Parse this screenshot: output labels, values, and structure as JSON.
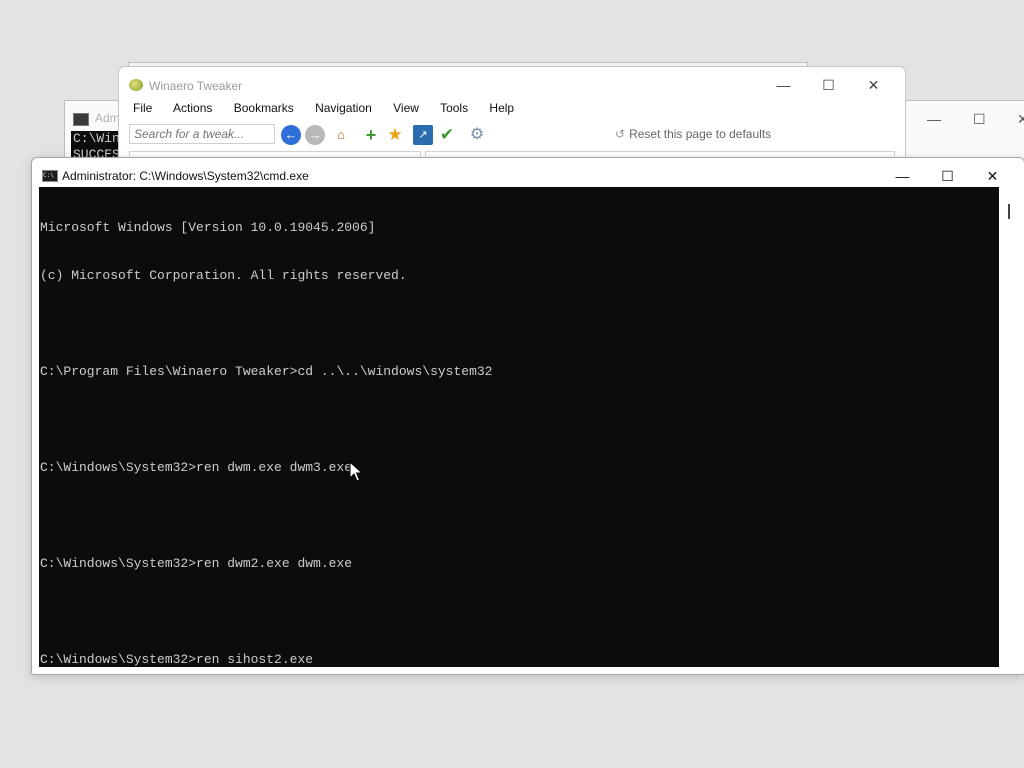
{
  "background_windows": {
    "back_cmd": {
      "title": "Admi",
      "console_lines": [
        "C:\\Win",
        "SUCCES"
      ]
    },
    "right_window_controls": [
      "—",
      "☐",
      "✕"
    ]
  },
  "winaero": {
    "title": "Winaero Tweaker",
    "controls": {
      "minimize": "—",
      "maximize": "☐",
      "close": "✕"
    },
    "menu": [
      "File",
      "Actions",
      "Bookmarks",
      "Navigation",
      "View",
      "Tools",
      "Help"
    ],
    "search_placeholder": "Search for a tweak...",
    "reset_label": "Reset this page to defaults"
  },
  "cmd": {
    "title": "Administrator: C:\\Windows\\System32\\cmd.exe",
    "controls": {
      "minimize": "—",
      "maximize": "☐",
      "close": "✕"
    },
    "lines": [
      "Microsoft Windows [Version 10.0.19045.2006]",
      "(c) Microsoft Corporation. All rights reserved.",
      "",
      "C:\\Program Files\\Winaero Tweaker>cd ..\\..\\windows\\system32",
      "",
      "C:\\Windows\\System32>ren dwm.exe dwm3.exe",
      "",
      "C:\\Windows\\System32>ren dwm2.exe dwm.exe",
      "",
      "C:\\Windows\\System32>ren sihost2.exe"
    ]
  },
  "colors": {
    "desktop": "#e3e3e3",
    "console_bg": "#0c0c0c",
    "console_text": "#cccccc"
  }
}
